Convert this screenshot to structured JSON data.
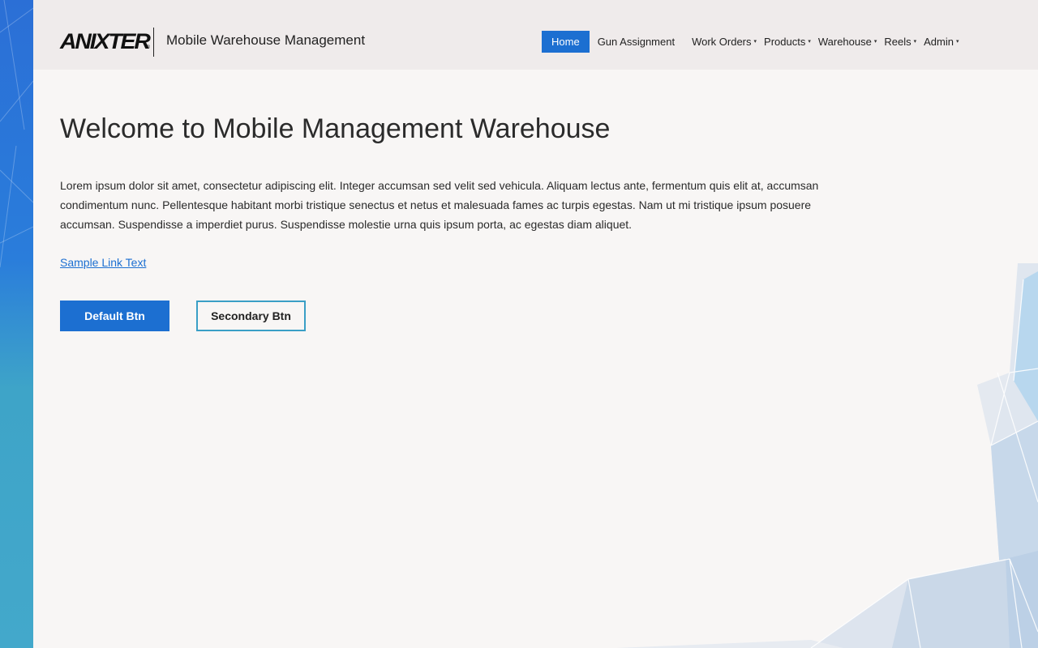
{
  "brand": {
    "logo_text": "ANIXTER",
    "logo_mark": "®",
    "app_title": "Mobile Warehouse Management"
  },
  "nav": {
    "items": [
      {
        "label": "Home",
        "active": true,
        "dropdown": false
      },
      {
        "label": "Gun Assignment",
        "active": false,
        "dropdown": false
      },
      {
        "label": "Work Orders",
        "active": false,
        "dropdown": true
      },
      {
        "label": "Products",
        "active": false,
        "dropdown": true
      },
      {
        "label": "Warehouse",
        "active": false,
        "dropdown": true
      },
      {
        "label": "Reels",
        "active": false,
        "dropdown": true
      },
      {
        "label": "Admin",
        "active": false,
        "dropdown": true
      }
    ],
    "caret_glyph": "▾"
  },
  "main": {
    "title": "Welcome to Mobile Management Warehouse",
    "body": "Lorem ipsum dolor sit amet, consectetur adipiscing elit. Integer accumsan sed velit sed vehicula. Aliquam lectus ante, fermentum quis elit at, accumsan condimentum nunc. Pellentesque habitant morbi tristique senectus et netus et malesuada fames ac turpis egestas. Nam ut mi tristique ipsum posuere accumsan. Suspendisse a imperdiet purus. Suspendisse molestie urna quis ipsum porta, ac egestas diam aliquet.",
    "link_text": "Sample Link Text",
    "default_button": "Default Btn",
    "secondary_button": "Secondary Btn"
  },
  "colors": {
    "primary": "#1c6fd1",
    "secondary_border": "#3a9fc6",
    "header_bg": "#efebeb",
    "page_bg": "#f8f6f5"
  }
}
